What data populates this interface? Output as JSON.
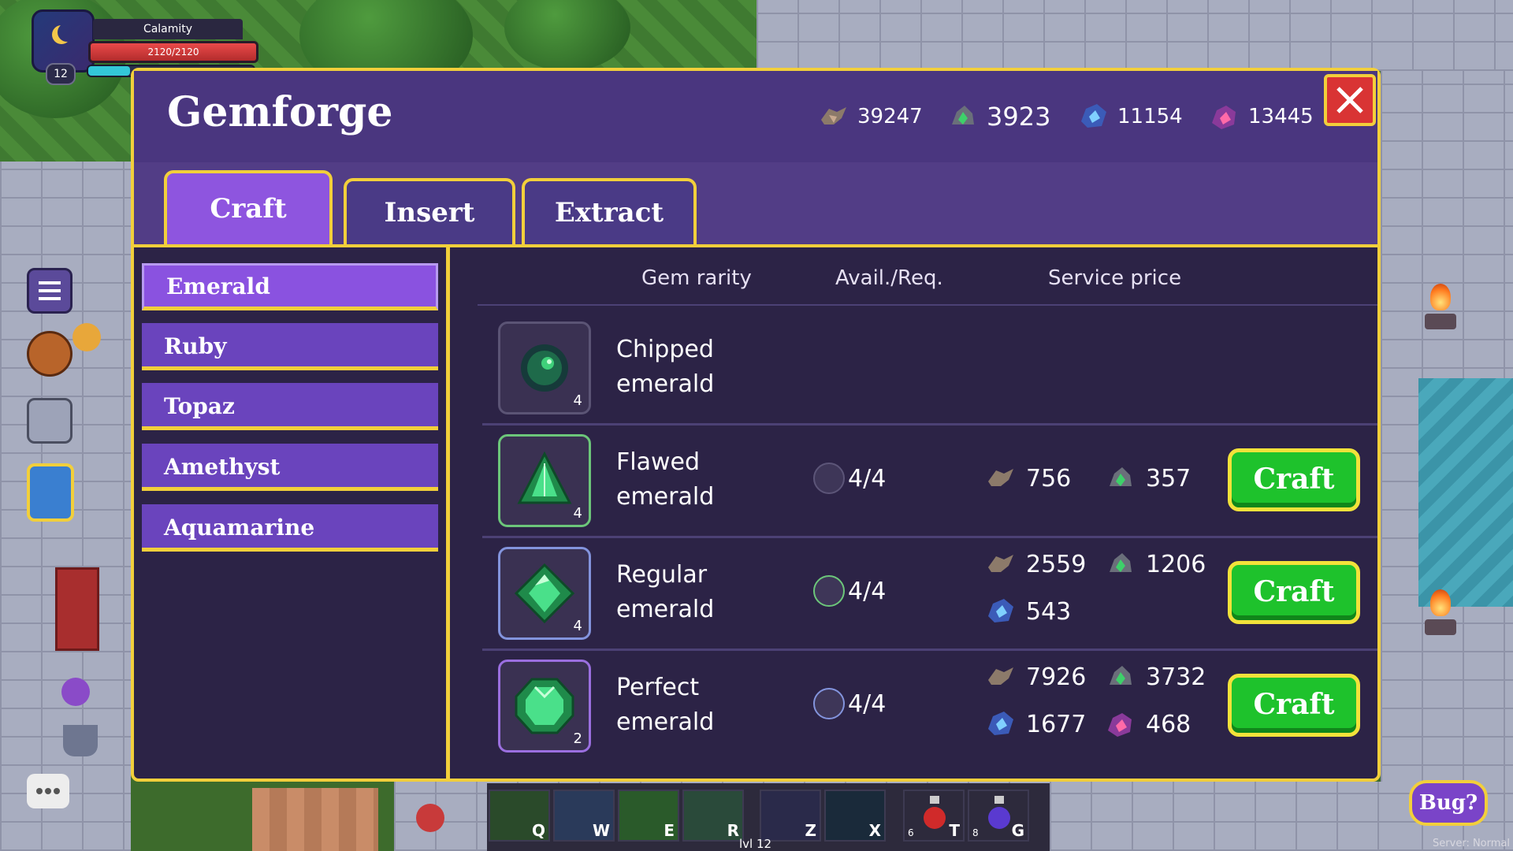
{
  "player": {
    "name": "Calamity",
    "hp": "2120/2120",
    "level": "12"
  },
  "panel": {
    "title": "Gemforge",
    "currencies": [
      {
        "icon": "brown-ore-icon",
        "amount": "39247"
      },
      {
        "icon": "green-ore-icon",
        "amount": "3923"
      },
      {
        "icon": "blue-ore-icon",
        "amount": "11154"
      },
      {
        "icon": "purple-ore-icon",
        "amount": "13445"
      }
    ],
    "tabs": [
      {
        "label": "Craft",
        "active": true
      },
      {
        "label": "Insert",
        "active": false
      },
      {
        "label": "Extract",
        "active": false
      }
    ],
    "gem_types": [
      {
        "label": "Emerald",
        "active": true
      },
      {
        "label": "Ruby",
        "active": false
      },
      {
        "label": "Topaz",
        "active": false
      },
      {
        "label": "Amethyst",
        "active": false
      },
      {
        "label": "Aquamarine",
        "active": false
      }
    ],
    "columns": {
      "rarity": "Gem rarity",
      "avail": "Avail./Req.",
      "price": "Service price"
    },
    "rows": [
      {
        "name1": "Chipped",
        "name2": "emerald",
        "count": "4"
      },
      {
        "name1": "Flawed",
        "name2": "emerald",
        "count": "4",
        "avail": "4/4",
        "price": {
          "brown": "756",
          "green": "357"
        },
        "craft": "Craft"
      },
      {
        "name1": "Regular",
        "name2": "emerald",
        "count": "4",
        "avail": "4/4",
        "price": {
          "brown": "2559",
          "green": "1206",
          "blue": "543"
        },
        "craft": "Craft"
      },
      {
        "name1": "Perfect",
        "name2": "emerald",
        "count": "2",
        "avail": "4/4",
        "price": {
          "brown": "7926",
          "green": "3732",
          "blue": "1677",
          "purple": "468"
        },
        "craft": "Craft"
      }
    ]
  },
  "action_bar": {
    "keys": [
      "Q",
      "W",
      "E",
      "R",
      "Z",
      "X",
      "T",
      "G"
    ],
    "item_counts": {
      "T": "6",
      "G": "8"
    },
    "level_label": "lvl 12"
  },
  "bug_button": "Bug?",
  "server_label": "Server: Normal",
  "colors": {
    "panel_border": "#f2cf3b",
    "header": "#4a367f",
    "craft_button": "#1ec22c",
    "close_button": "#d93434"
  }
}
